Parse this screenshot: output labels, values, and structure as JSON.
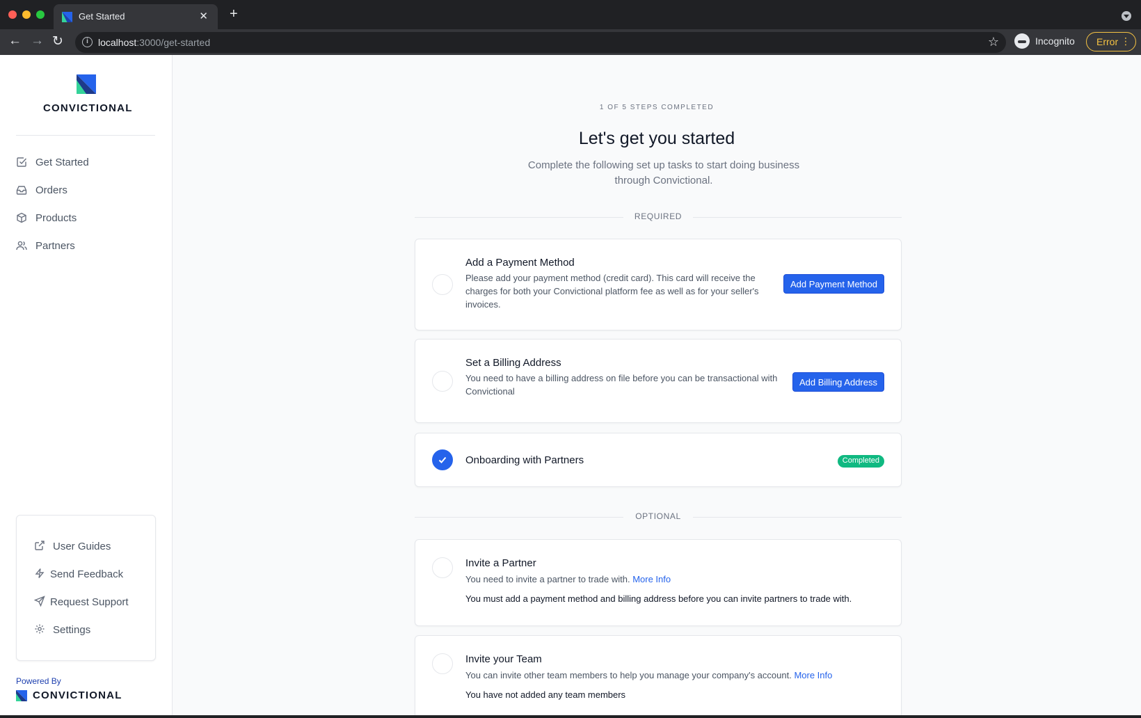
{
  "browser": {
    "tab_title": "Get Started",
    "url_host": "localhost",
    "url_path": ":3000/get-started",
    "incognito_label": "Incognito",
    "error_label": "Error"
  },
  "sidebar": {
    "brand": "CONVICTIONAL",
    "nav": [
      {
        "label": "Get Started",
        "icon": "checkbox-icon"
      },
      {
        "label": "Orders",
        "icon": "inbox-icon"
      },
      {
        "label": "Products",
        "icon": "box-icon"
      },
      {
        "label": "Partners",
        "icon": "users-icon"
      }
    ],
    "help": [
      {
        "label": "User Guides",
        "icon": "external-link-icon"
      },
      {
        "label": "Send Feedback",
        "icon": "lightning-icon"
      },
      {
        "label": "Request Support",
        "icon": "send-icon"
      },
      {
        "label": "Settings",
        "icon": "gear-icon"
      }
    ],
    "powered_by": "Powered By",
    "powered_brand": "CONVICTIONAL"
  },
  "main": {
    "steps_completed": "1 OF 5 STEPS COMPLETED",
    "title": "Let's get you started",
    "subtitle": "Complete the following set up tasks to start doing business through Convictional.",
    "required_label": "REQUIRED",
    "optional_label": "OPTIONAL",
    "tasks": [
      {
        "title": "Add a Payment Method",
        "description": "Please add your payment method (credit card). This card will receive the charges for both your Convictional platform fee as well as for your seller's invoices.",
        "button": "Add Payment Method"
      },
      {
        "title": "Set a Billing Address",
        "description": "You need to have a billing address on file before you can be transactional with Convictional",
        "button": "Add Billing Address"
      },
      {
        "title": "Onboarding with Partners",
        "badge": "Completed"
      }
    ],
    "optional_tasks": [
      {
        "title": "Invite a Partner",
        "description": "You need to invite a partner to trade with.",
        "link": "More Info",
        "note": "You must add a payment method and billing address before you can invite partners to trade with."
      },
      {
        "title": "Invite your Team",
        "description": "You can invite other team members to help you manage your company's account.",
        "link": "More Info",
        "note": "You have not added any team members"
      }
    ]
  },
  "colors": {
    "accent": "#2563eb",
    "success": "#10b981",
    "brand_green": "#34d399",
    "brand_blue": "#2563eb"
  }
}
